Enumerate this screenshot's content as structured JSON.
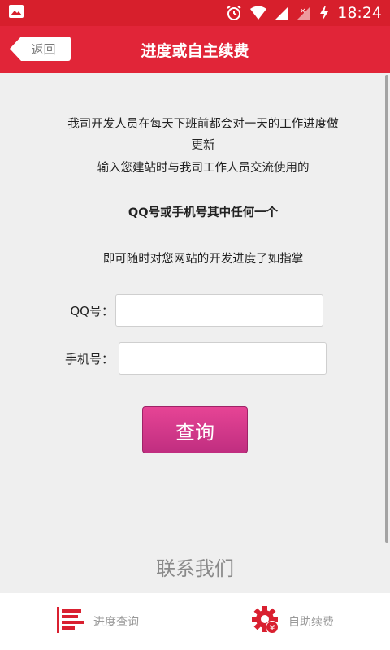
{
  "statusbar": {
    "time": "18:24",
    "icons": [
      "image-icon",
      "alarm-icon",
      "wifi-icon",
      "signal-icon",
      "signal-no-data-icon",
      "battery-charging-icon"
    ]
  },
  "header": {
    "back_label": "返回",
    "title": "进度或自主续费"
  },
  "intro": {
    "line1": "我司开发人员在每天下班前都会对一天的工作进度做",
    "line2": "更新",
    "line3": "输入您建站时与我司工作人员交流使用的",
    "highlight": "QQ号或手机号其中任何一个",
    "line4": "即可随时对您网站的开发进度了如指掌"
  },
  "form": {
    "qq_label": "QQ号：",
    "qq_value": "",
    "phone_label": "手机号：",
    "phone_value": "",
    "submit_label": "查询"
  },
  "contact": {
    "label": "联系我们"
  },
  "bottom_nav": {
    "items": [
      {
        "label": "进度查询",
        "icon": "progress-bars-icon"
      },
      {
        "label": "自助续费",
        "icon": "gear-yen-icon"
      }
    ]
  },
  "colors": {
    "statusbar": "#d71f2c",
    "appbar": "#e12538",
    "button": "#d43a8a",
    "nav_icon": "#d92030"
  }
}
